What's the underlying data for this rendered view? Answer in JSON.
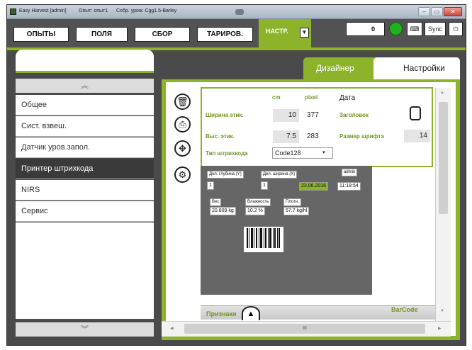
{
  "window": {
    "title": "Easy Harvest [admin]",
    "experiment": "Опыт: опыт1",
    "harvest": "Собр. урож: Cgg1.5-Barley",
    "controls": [
      "–",
      "▭",
      "✕"
    ]
  },
  "toolbar": {
    "buttons": [
      "ОПЫТЫ",
      "ПОЛЯ",
      "СБОР",
      "ТАРИРОВ.",
      "НАСТР."
    ],
    "counter": "0",
    "sync": "Sync"
  },
  "status_color": "#20b020",
  "accent_color": "#8db32b",
  "tabs": [
    "Дизайнер",
    "Настройки"
  ],
  "menu": [
    "Общее",
    "Сист. взвеш.",
    "Датчик уров.запол.",
    "Принтер штрихкода",
    "NIRS",
    "Сервис"
  ],
  "menu_selected": "Принтер штрихкода",
  "tools": [
    "trash-icon",
    "printer-icon",
    "move-icon",
    "gears-icon"
  ],
  "form": {
    "col_cm": "cm",
    "col_pixel": "pixel",
    "col_date": "Дата",
    "width_label": "Ширина этик.",
    "width_cm": "10",
    "width_px": "377",
    "header_label": "Заголовок",
    "height_label": "Выс. этик.",
    "height_cm": "7.5",
    "height_px": "283",
    "font_label": "Размер шрифта",
    "font_value": "14",
    "barcode_type_label": "Тип штрихкода",
    "barcode_type": "Code128"
  },
  "preview": {
    "depth_label": "Дел. глубина (Y)",
    "depth_val": "1",
    "width_label": "Дел. ширина (X)",
    "width_val": "1",
    "user": "admin",
    "date": "23.06.2016",
    "time": "11:18:54",
    "weight_label": "Вес",
    "weight_val": "20.809 kg",
    "moisture_label": "Влажность",
    "moisture_val": "10.2 %",
    "density_label": "Плотн.",
    "density_val": "57.7 kg/hl"
  },
  "bottom": {
    "features": "Признаки",
    "barcode": "BarCode",
    "scroll_mark": "III"
  }
}
